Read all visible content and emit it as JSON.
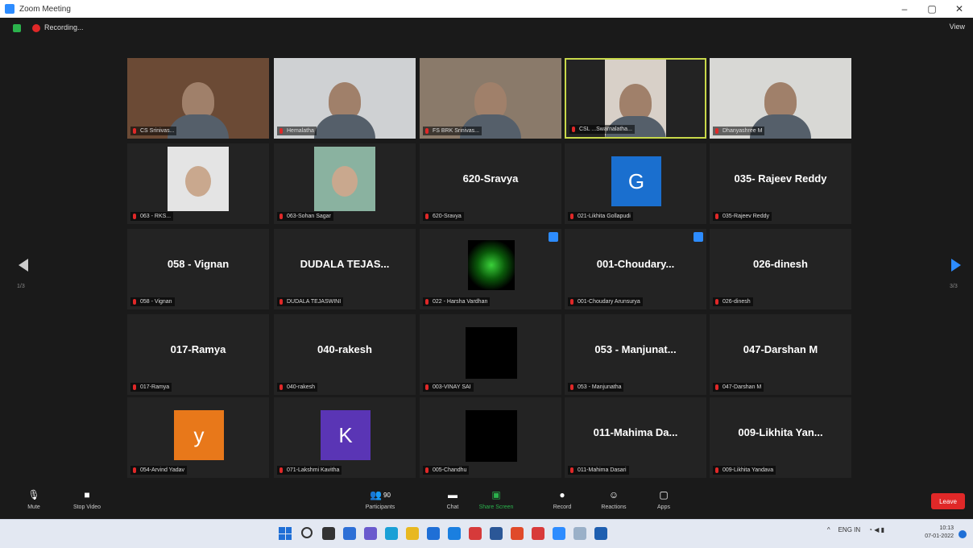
{
  "window": {
    "title": "Zoom Meeting",
    "minimize": "–",
    "maximize": "▢",
    "close": "✕"
  },
  "meeting": {
    "recording_label": "Recording...",
    "view_label": "View"
  },
  "tiles": [
    {
      "display": "",
      "label": "CS Srinivas...",
      "kind": "video",
      "bg": "#6b4a35"
    },
    {
      "display": "",
      "label": "Hemalatha",
      "kind": "video",
      "bg": "#cfd1d3"
    },
    {
      "display": "",
      "label": "FS BRK Srinivas...",
      "kind": "video",
      "bg": "#8a7a6a"
    },
    {
      "display": "",
      "label": "CSL ...Swarnalatha...",
      "kind": "video",
      "bg": "#2a2a2a",
      "active": true
    },
    {
      "display": "",
      "label": "Dhanyashree M",
      "kind": "video",
      "bg": "#d8d8d5"
    },
    {
      "display": "",
      "label": "063 - RKS...",
      "kind": "smallvideo",
      "bg": "#e4e4e4"
    },
    {
      "display": "",
      "label": "063-Sohan Sagar",
      "kind": "smallvideo",
      "bg": "#8ab2a0"
    },
    {
      "display": "620-Sravya",
      "label": "620-Sravya",
      "kind": "name"
    },
    {
      "display": "",
      "label": "021-Likhita Gollapudi",
      "kind": "avatar",
      "letter": "G",
      "color": "#1a6fcf"
    },
    {
      "display": "035- Rajeev Reddy",
      "label": "035-Rajeev Reddy",
      "kind": "name"
    },
    {
      "display": "058 - Vignan",
      "label": "058 - Vignan",
      "kind": "name"
    },
    {
      "display": "DUDALA TEJAS...",
      "label": "DUDALA TEJASWINI",
      "kind": "name"
    },
    {
      "display": "",
      "label": "022 - Harsha Vardhan",
      "kind": "greenimg",
      "corner": true
    },
    {
      "display": "001-Choudary...",
      "label": "001-Choudary Arunsurya",
      "kind": "name",
      "corner": true
    },
    {
      "display": "026-dinesh",
      "label": "026-dinesh",
      "kind": "name"
    },
    {
      "display": "017-Ramya",
      "label": "017-Ramya",
      "kind": "name"
    },
    {
      "display": "040-rakesh",
      "label": "040-rakesh",
      "kind": "name"
    },
    {
      "display": "",
      "label": "003-VINAY SAI",
      "kind": "black"
    },
    {
      "display": "053 - Manjunat...",
      "label": "053 - Manjunatha",
      "kind": "name"
    },
    {
      "display": "047-Darshan M",
      "label": "047-Darshan M",
      "kind": "name"
    },
    {
      "display": "",
      "label": "054-Arvind Yadav",
      "kind": "avatar",
      "letter": "y",
      "color": "#e8781a"
    },
    {
      "display": "",
      "label": "071-Lakshmi Kavitha",
      "kind": "avatar",
      "letter": "K",
      "color": "#5a35b5"
    },
    {
      "display": "",
      "label": "005-Chandhu",
      "kind": "black"
    },
    {
      "display": "011-Mahima Da...",
      "label": "011-Mahima Dasari",
      "kind": "name"
    },
    {
      "display": "009-Likhita Yan...",
      "label": "009-Likhita Yandava",
      "kind": "name"
    }
  ],
  "nav": {
    "left_page": "1/3",
    "right_page": "3/3"
  },
  "toolbar": {
    "mute": "Mute",
    "stop_video": "Stop Video",
    "participants": "Participants",
    "participants_count": "90",
    "chat": "Chat",
    "share_screen": "Share Screen",
    "record": "Record",
    "reactions": "Reactions",
    "apps": "Apps",
    "leave": "Leave"
  },
  "taskbar": {
    "tray_lang": "ENG IN",
    "time": "10:13",
    "date": "07-01-2022"
  },
  "colors": {
    "accent": "#2d8cff",
    "leave": "#e02828",
    "active_border": "#c8d84a"
  }
}
